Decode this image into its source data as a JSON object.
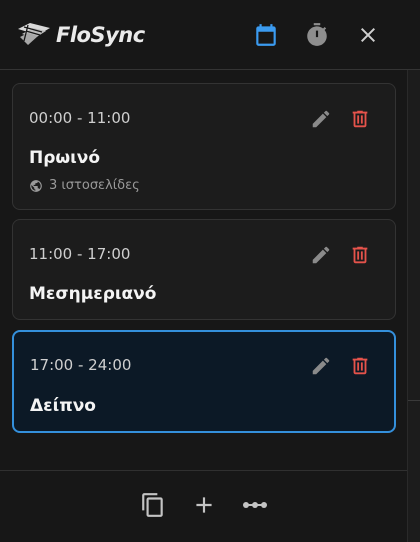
{
  "app": {
    "brand": "FloSync"
  },
  "schedules": [
    {
      "time": "00:00 - 11:00",
      "name": "Πρωινό",
      "meta": "3 ιστοσελίδες"
    },
    {
      "time": "11:00 - 17:00",
      "name": "Μεσημεριανό"
    },
    {
      "time": "17:00 - 24:00",
      "name": "Δείπνο"
    }
  ],
  "colors": {
    "accent": "#3490dc",
    "delete": "#e5534b",
    "background": "#171717"
  },
  "icons": {
    "header": [
      "calendar-icon",
      "timer-icon",
      "close-icon"
    ],
    "card_actions": [
      "edit-icon",
      "delete-icon"
    ],
    "footer": [
      "copy-icon",
      "add-icon",
      "more-icon"
    ]
  }
}
